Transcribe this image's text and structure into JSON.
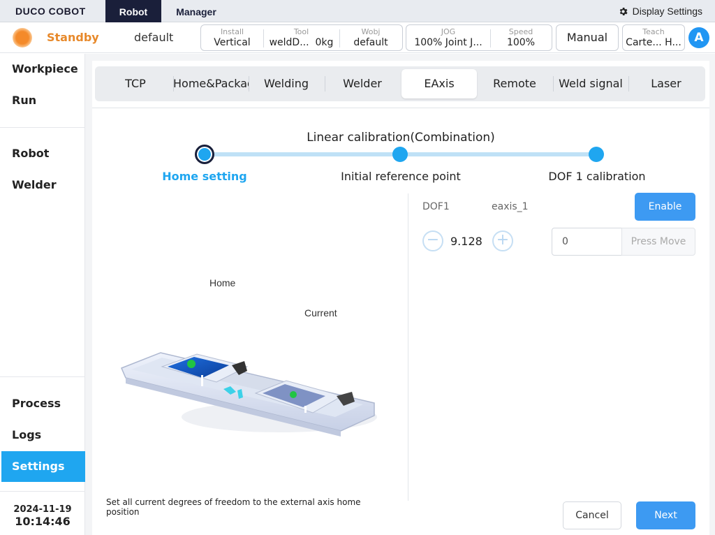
{
  "app": {
    "logo": "DUCO COBOT"
  },
  "top_tabs": {
    "robot": "Robot",
    "manager": "Manager"
  },
  "display_settings": {
    "label": "Display Settings",
    "icon": "gear-icon"
  },
  "status": {
    "state": "Standby",
    "state_color": "#e7892b",
    "project": "default",
    "install_label": "Install",
    "install_value": "Vertical",
    "tool_label": "Tool",
    "tool_value": "weldD...",
    "tool_weight": "0kg",
    "wobj_label": "Wobj",
    "wobj_value": "default",
    "jog_label": "JOG",
    "jog_value": "100% Joint J...",
    "speed_label": "Speed",
    "speed_value": "100%",
    "mode": "Manual",
    "teach_label": "Teach",
    "teach_value": "Carte... H...",
    "avatar": "A"
  },
  "sidebar": {
    "items": [
      {
        "label": "Workpiece"
      },
      {
        "label": "Run"
      },
      {
        "label": "Robot"
      },
      {
        "label": "Welder"
      },
      {
        "label": "Process"
      },
      {
        "label": "Logs"
      },
      {
        "label": "Settings"
      }
    ],
    "date": "2024-11-19",
    "time": "10:14:46",
    "accent": "#1fa6f0"
  },
  "tabs": [
    "TCP",
    "Home&Package",
    "Welding",
    "Welder",
    "EAxis",
    "Remote",
    "Weld signal",
    "Laser"
  ],
  "active_tab": "EAxis",
  "calibration": {
    "title": "Linear calibration(Combination)",
    "steps": [
      "Home setting",
      "Initial reference point",
      "DOF 1 calibration"
    ],
    "current_step": 1
  },
  "dof": {
    "label": "DOF1",
    "axis": "eaxis_1",
    "enable_label": "Enable",
    "value": "9.128",
    "input_value": "0",
    "press_move_label": "Press Move"
  },
  "illustration": {
    "home_label": "Home",
    "current_label": "Current"
  },
  "instruction": "Set all current degrees of freedom to the external axis home position",
  "footer": {
    "cancel_label": "Cancel",
    "next_label": "Next"
  }
}
